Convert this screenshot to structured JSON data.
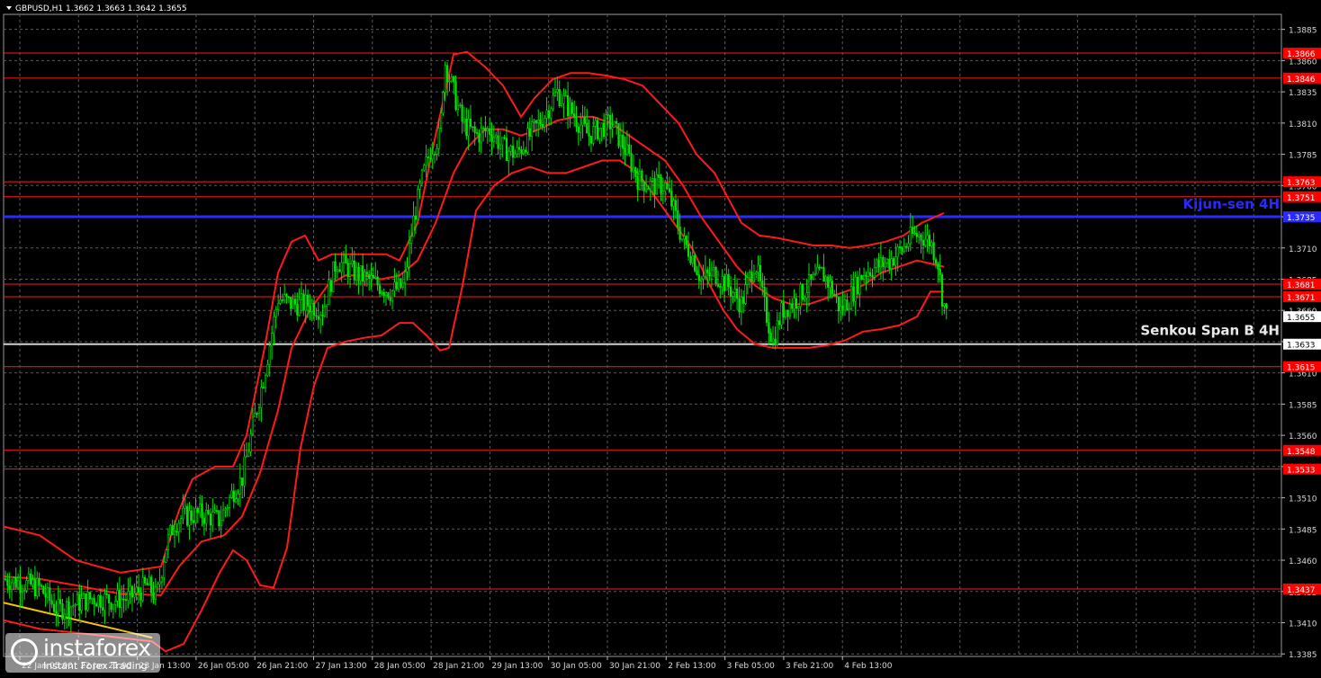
{
  "chart_data": {
    "type": "candlestick",
    "symbol_header": "GBPUSD,H1  1.3662 1.3663 1.3642 1.3655",
    "current_price": 1.3655,
    "ylim": [
      1.3383,
      1.3897
    ],
    "y_ticks": [
      "1.3885",
      "1.3860",
      "1.3835",
      "1.3810",
      "1.3785",
      "1.3760",
      "1.3735",
      "1.3710",
      "1.3685",
      "1.3660",
      "1.3635",
      "1.3610",
      "1.3585",
      "1.3560",
      "1.3535",
      "1.3510",
      "1.3485",
      "1.3460",
      "1.3435",
      "1.3410",
      "1.3385"
    ],
    "x_ticks": [
      "22 Jan 05:00",
      "22 Jan 21:00",
      "23 Jan 13:00",
      "26 Jan 05:00",
      "26 Jan 21:00",
      "27 Jan 13:00",
      "28 Jan 05:00",
      "28 Jan 21:00",
      "29 Jan 13:00",
      "30 Jan 05:00",
      "30 Jan 21:00",
      "2 Feb 13:00",
      "3 Feb 05:00",
      "3 Feb 21:00",
      "4 Feb 13:00"
    ],
    "level_lines": [
      {
        "label": "1.3866",
        "value": 1.3866
      },
      {
        "label": "1.3846",
        "value": 1.3846
      },
      {
        "label": "1.3763",
        "value": 1.3763
      },
      {
        "label": "1.3751",
        "value": 1.3751
      },
      {
        "label": "1.3681",
        "value": 1.3681
      },
      {
        "label": "1.3671",
        "value": 1.3671
      },
      {
        "label": "1.3615",
        "value": 1.3615
      },
      {
        "label": "1.3548",
        "value": 1.3548
      },
      {
        "label": "1.3533",
        "value": 1.3533
      },
      {
        "label": "1.3437",
        "value": 1.3437
      }
    ],
    "kijun_sen": {
      "label": "Kijun-sen 4H",
      "value": 1.3735,
      "price_label": "1.3735"
    },
    "senkou_span_b": {
      "label": "Senkou Span B 4H",
      "value": 1.3633,
      "price_label": "1.3633"
    },
    "price_path": [
      [
        0,
        1.3445
      ],
      [
        20,
        1.3442
      ],
      [
        40,
        1.3438
      ],
      [
        60,
        1.342
      ],
      [
        80,
        1.3425
      ],
      [
        100,
        1.343
      ],
      [
        120,
        1.3428
      ],
      [
        140,
        1.343
      ],
      [
        160,
        1.344
      ],
      [
        170,
        1.343
      ],
      [
        180,
        1.347
      ],
      [
        190,
        1.349
      ],
      [
        200,
        1.3495
      ],
      [
        220,
        1.3497
      ],
      [
        240,
        1.3492
      ],
      [
        255,
        1.3515
      ],
      [
        265,
        1.3525
      ],
      [
        275,
        1.356
      ],
      [
        290,
        1.361
      ],
      [
        305,
        1.367
      ],
      [
        320,
        1.3665
      ],
      [
        340,
        1.3665
      ],
      [
        355,
        1.366
      ],
      [
        370,
        1.37
      ],
      [
        390,
        1.369
      ],
      [
        410,
        1.3683
      ],
      [
        430,
        1.3675
      ],
      [
        445,
        1.368
      ],
      [
        455,
        1.373
      ],
      [
        465,
        1.3765
      ],
      [
        475,
        1.379
      ],
      [
        485,
        1.38
      ],
      [
        490,
        1.386
      ],
      [
        500,
        1.3835
      ],
      [
        510,
        1.381
      ],
      [
        525,
        1.38
      ],
      [
        540,
        1.3805
      ],
      [
        555,
        1.379
      ],
      [
        570,
        1.3785
      ],
      [
        585,
        1.38
      ],
      [
        600,
        1.3815
      ],
      [
        615,
        1.3835
      ],
      [
        630,
        1.382
      ],
      [
        640,
        1.381
      ],
      [
        650,
        1.38
      ],
      [
        660,
        1.3805
      ],
      [
        675,
        1.381
      ],
      [
        690,
        1.379
      ],
      [
        705,
        1.3765
      ],
      [
        720,
        1.376
      ],
      [
        735,
        1.376
      ],
      [
        745,
        1.374
      ],
      [
        755,
        1.3715
      ],
      [
        765,
        1.3705
      ],
      [
        775,
        1.3685
      ],
      [
        790,
        1.369
      ],
      [
        805,
        1.368
      ],
      [
        820,
        1.3665
      ],
      [
        835,
        1.37
      ],
      [
        845,
        1.3665
      ],
      [
        855,
        1.3635
      ],
      [
        865,
        1.366
      ],
      [
        880,
        1.3668
      ],
      [
        895,
        1.368
      ],
      [
        910,
        1.369
      ],
      [
        920,
        1.3678
      ],
      [
        930,
        1.366
      ],
      [
        940,
        1.367
      ],
      [
        955,
        1.369
      ],
      [
        970,
        1.3695
      ],
      [
        985,
        1.37
      ],
      [
        1000,
        1.371
      ],
      [
        1010,
        1.372
      ],
      [
        1020,
        1.372
      ],
      [
        1030,
        1.3715
      ],
      [
        1038,
        1.37
      ],
      [
        1043,
        1.3672
      ],
      [
        1048,
        1.3655
      ]
    ],
    "trend_line": [
      [
        0,
        1.3426
      ],
      [
        165,
        1.3398
      ]
    ],
    "bollinger": {
      "upper": [
        [
          0,
          1.3487
        ],
        [
          40,
          1.348
        ],
        [
          80,
          1.346
        ],
        [
          130,
          1.345
        ],
        [
          175,
          1.3455
        ],
        [
          195,
          1.35
        ],
        [
          210,
          1.3525
        ],
        [
          235,
          1.3535
        ],
        [
          255,
          1.3535
        ],
        [
          270,
          1.356
        ],
        [
          290,
          1.363
        ],
        [
          305,
          1.369
        ],
        [
          320,
          1.3715
        ],
        [
          335,
          1.372
        ],
        [
          350,
          1.37
        ],
        [
          365,
          1.3705
        ],
        [
          385,
          1.3705
        ],
        [
          405,
          1.3705
        ],
        [
          425,
          1.3705
        ],
        [
          440,
          1.37
        ],
        [
          460,
          1.373
        ],
        [
          480,
          1.38
        ],
        [
          500,
          1.3865
        ],
        [
          515,
          1.3867
        ],
        [
          535,
          1.3855
        ],
        [
          555,
          1.384
        ],
        [
          575,
          1.3815
        ],
        [
          590,
          1.383
        ],
        [
          610,
          1.3845
        ],
        [
          630,
          1.385
        ],
        [
          650,
          1.385
        ],
        [
          670,
          1.3848
        ],
        [
          690,
          1.3845
        ],
        [
          710,
          1.384
        ],
        [
          730,
          1.3825
        ],
        [
          750,
          1.381
        ],
        [
          770,
          1.3785
        ],
        [
          790,
          1.377
        ],
        [
          805,
          1.375
        ],
        [
          820,
          1.373
        ],
        [
          840,
          1.372
        ],
        [
          860,
          1.3718
        ],
        [
          880,
          1.3715
        ],
        [
          900,
          1.3712
        ],
        [
          920,
          1.3712
        ],
        [
          940,
          1.371
        ],
        [
          960,
          1.3712
        ],
        [
          980,
          1.3715
        ],
        [
          1000,
          1.372
        ],
        [
          1020,
          1.373
        ],
        [
          1045,
          1.3738
        ]
      ],
      "middle": [
        [
          0,
          1.3447
        ],
        [
          40,
          1.3445
        ],
        [
          80,
          1.344
        ],
        [
          130,
          1.3433
        ],
        [
          175,
          1.3432
        ],
        [
          195,
          1.3455
        ],
        [
          220,
          1.3475
        ],
        [
          245,
          1.348
        ],
        [
          265,
          1.3495
        ],
        [
          285,
          1.353
        ],
        [
          305,
          1.358
        ],
        [
          320,
          1.363
        ],
        [
          340,
          1.366
        ],
        [
          360,
          1.368
        ],
        [
          380,
          1.3688
        ],
        [
          400,
          1.3688
        ],
        [
          420,
          1.3685
        ],
        [
          440,
          1.3688
        ],
        [
          460,
          1.37
        ],
        [
          480,
          1.373
        ],
        [
          500,
          1.377
        ],
        [
          515,
          1.379
        ],
        [
          535,
          1.3805
        ],
        [
          555,
          1.3805
        ],
        [
          575,
          1.38
        ],
        [
          595,
          1.3805
        ],
        [
          615,
          1.3812
        ],
        [
          635,
          1.3815
        ],
        [
          655,
          1.3815
        ],
        [
          675,
          1.381
        ],
        [
          695,
          1.38
        ],
        [
          715,
          1.379
        ],
        [
          735,
          1.378
        ],
        [
          755,
          1.376
        ],
        [
          775,
          1.3735
        ],
        [
          795,
          1.3715
        ],
        [
          815,
          1.3695
        ],
        [
          835,
          1.368
        ],
        [
          855,
          1.367
        ],
        [
          875,
          1.3665
        ],
        [
          895,
          1.3665
        ],
        [
          915,
          1.367
        ],
        [
          935,
          1.3675
        ],
        [
          955,
          1.368
        ],
        [
          975,
          1.369
        ],
        [
          995,
          1.3695
        ],
        [
          1015,
          1.37
        ],
        [
          1045,
          1.3695
        ]
      ],
      "lower": [
        [
          0,
          1.3412
        ],
        [
          40,
          1.3405
        ],
        [
          80,
          1.3402
        ],
        [
          130,
          1.3398
        ],
        [
          165,
          1.3395
        ],
        [
          180,
          1.3387
        ],
        [
          200,
          1.3393
        ],
        [
          220,
          1.342
        ],
        [
          240,
          1.345
        ],
        [
          255,
          1.3468
        ],
        [
          270,
          1.346
        ],
        [
          285,
          1.344
        ],
        [
          300,
          1.3438
        ],
        [
          315,
          1.347
        ],
        [
          330,
          1.355
        ],
        [
          345,
          1.36
        ],
        [
          360,
          1.363
        ],
        [
          380,
          1.3635
        ],
        [
          400,
          1.3638
        ],
        [
          420,
          1.364
        ],
        [
          440,
          1.365
        ],
        [
          455,
          1.365
        ],
        [
          470,
          1.364
        ],
        [
          485,
          1.3628
        ],
        [
          495,
          1.363
        ],
        [
          510,
          1.368
        ],
        [
          525,
          1.374
        ],
        [
          545,
          1.376
        ],
        [
          565,
          1.377
        ],
        [
          585,
          1.3775
        ],
        [
          605,
          1.377
        ],
        [
          625,
          1.377
        ],
        [
          645,
          1.3775
        ],
        [
          665,
          1.378
        ],
        [
          685,
          1.378
        ],
        [
          705,
          1.377
        ],
        [
          725,
          1.375
        ],
        [
          745,
          1.373
        ],
        [
          765,
          1.371
        ],
        [
          785,
          1.368
        ],
        [
          800,
          1.366
        ],
        [
          815,
          1.3645
        ],
        [
          835,
          1.3633
        ],
        [
          855,
          1.363
        ],
        [
          875,
          1.363
        ],
        [
          895,
          1.363
        ],
        [
          915,
          1.3632
        ],
        [
          935,
          1.3636
        ],
        [
          955,
          1.3643
        ],
        [
          975,
          1.3645
        ],
        [
          995,
          1.3648
        ],
        [
          1015,
          1.3655
        ],
        [
          1030,
          1.3675
        ],
        [
          1045,
          1.3675
        ]
      ]
    }
  },
  "watermark": {
    "brand": "instaforex",
    "tagline": "Instant Forex Trading"
  }
}
